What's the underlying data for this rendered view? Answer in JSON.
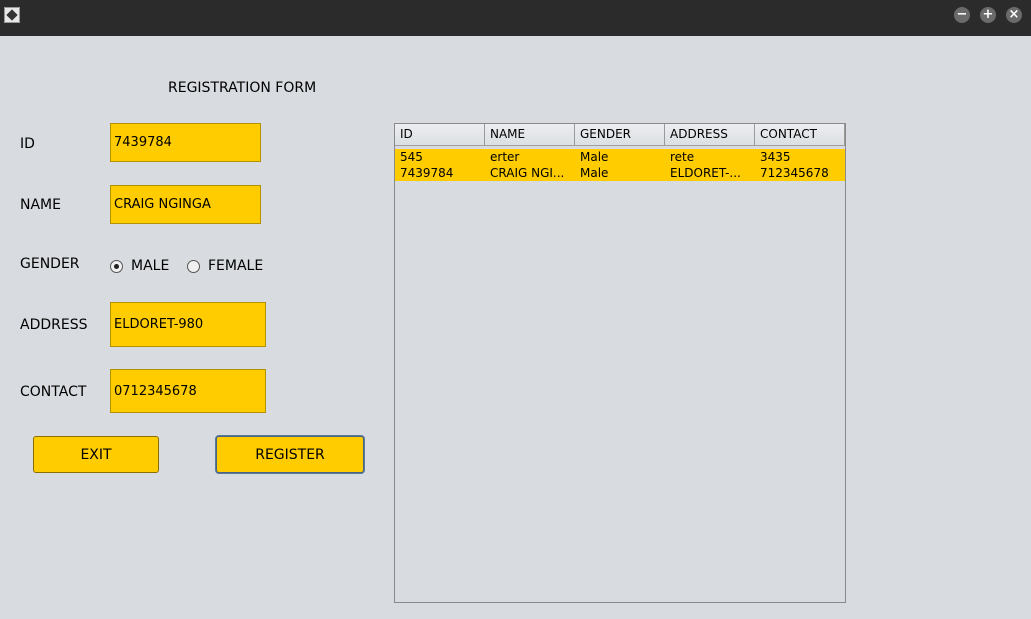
{
  "form": {
    "title": "REGISTRATION FORM",
    "id_label": "ID",
    "id_value": "7439784",
    "name_label": "NAME",
    "name_value": "CRAIG NGINGA",
    "gender_label": "GENDER",
    "gender_male": "MALE",
    "gender_female": "FEMALE",
    "gender_selected": "MALE",
    "address_label": "ADDRESS",
    "address_value": "ELDORET-980",
    "contact_label": "CONTACT",
    "contact_value": "0712345678",
    "exit_label": "EXIT",
    "register_label": "REGISTER"
  },
  "table": {
    "columns": [
      "ID",
      "NAME",
      "GENDER",
      "ADDRESS",
      "CONTACT"
    ],
    "rows": [
      [
        "545",
        "erter",
        "Male",
        "rete",
        "3435"
      ],
      [
        "7439784",
        "CRAIG NGI...",
        "Male",
        "ELDORET-...",
        "712345678"
      ]
    ]
  },
  "colors": {
    "field_bg": "#ffcc00",
    "window_bg": "#d8dbe0",
    "titlebar_bg": "#2b2b2b"
  }
}
